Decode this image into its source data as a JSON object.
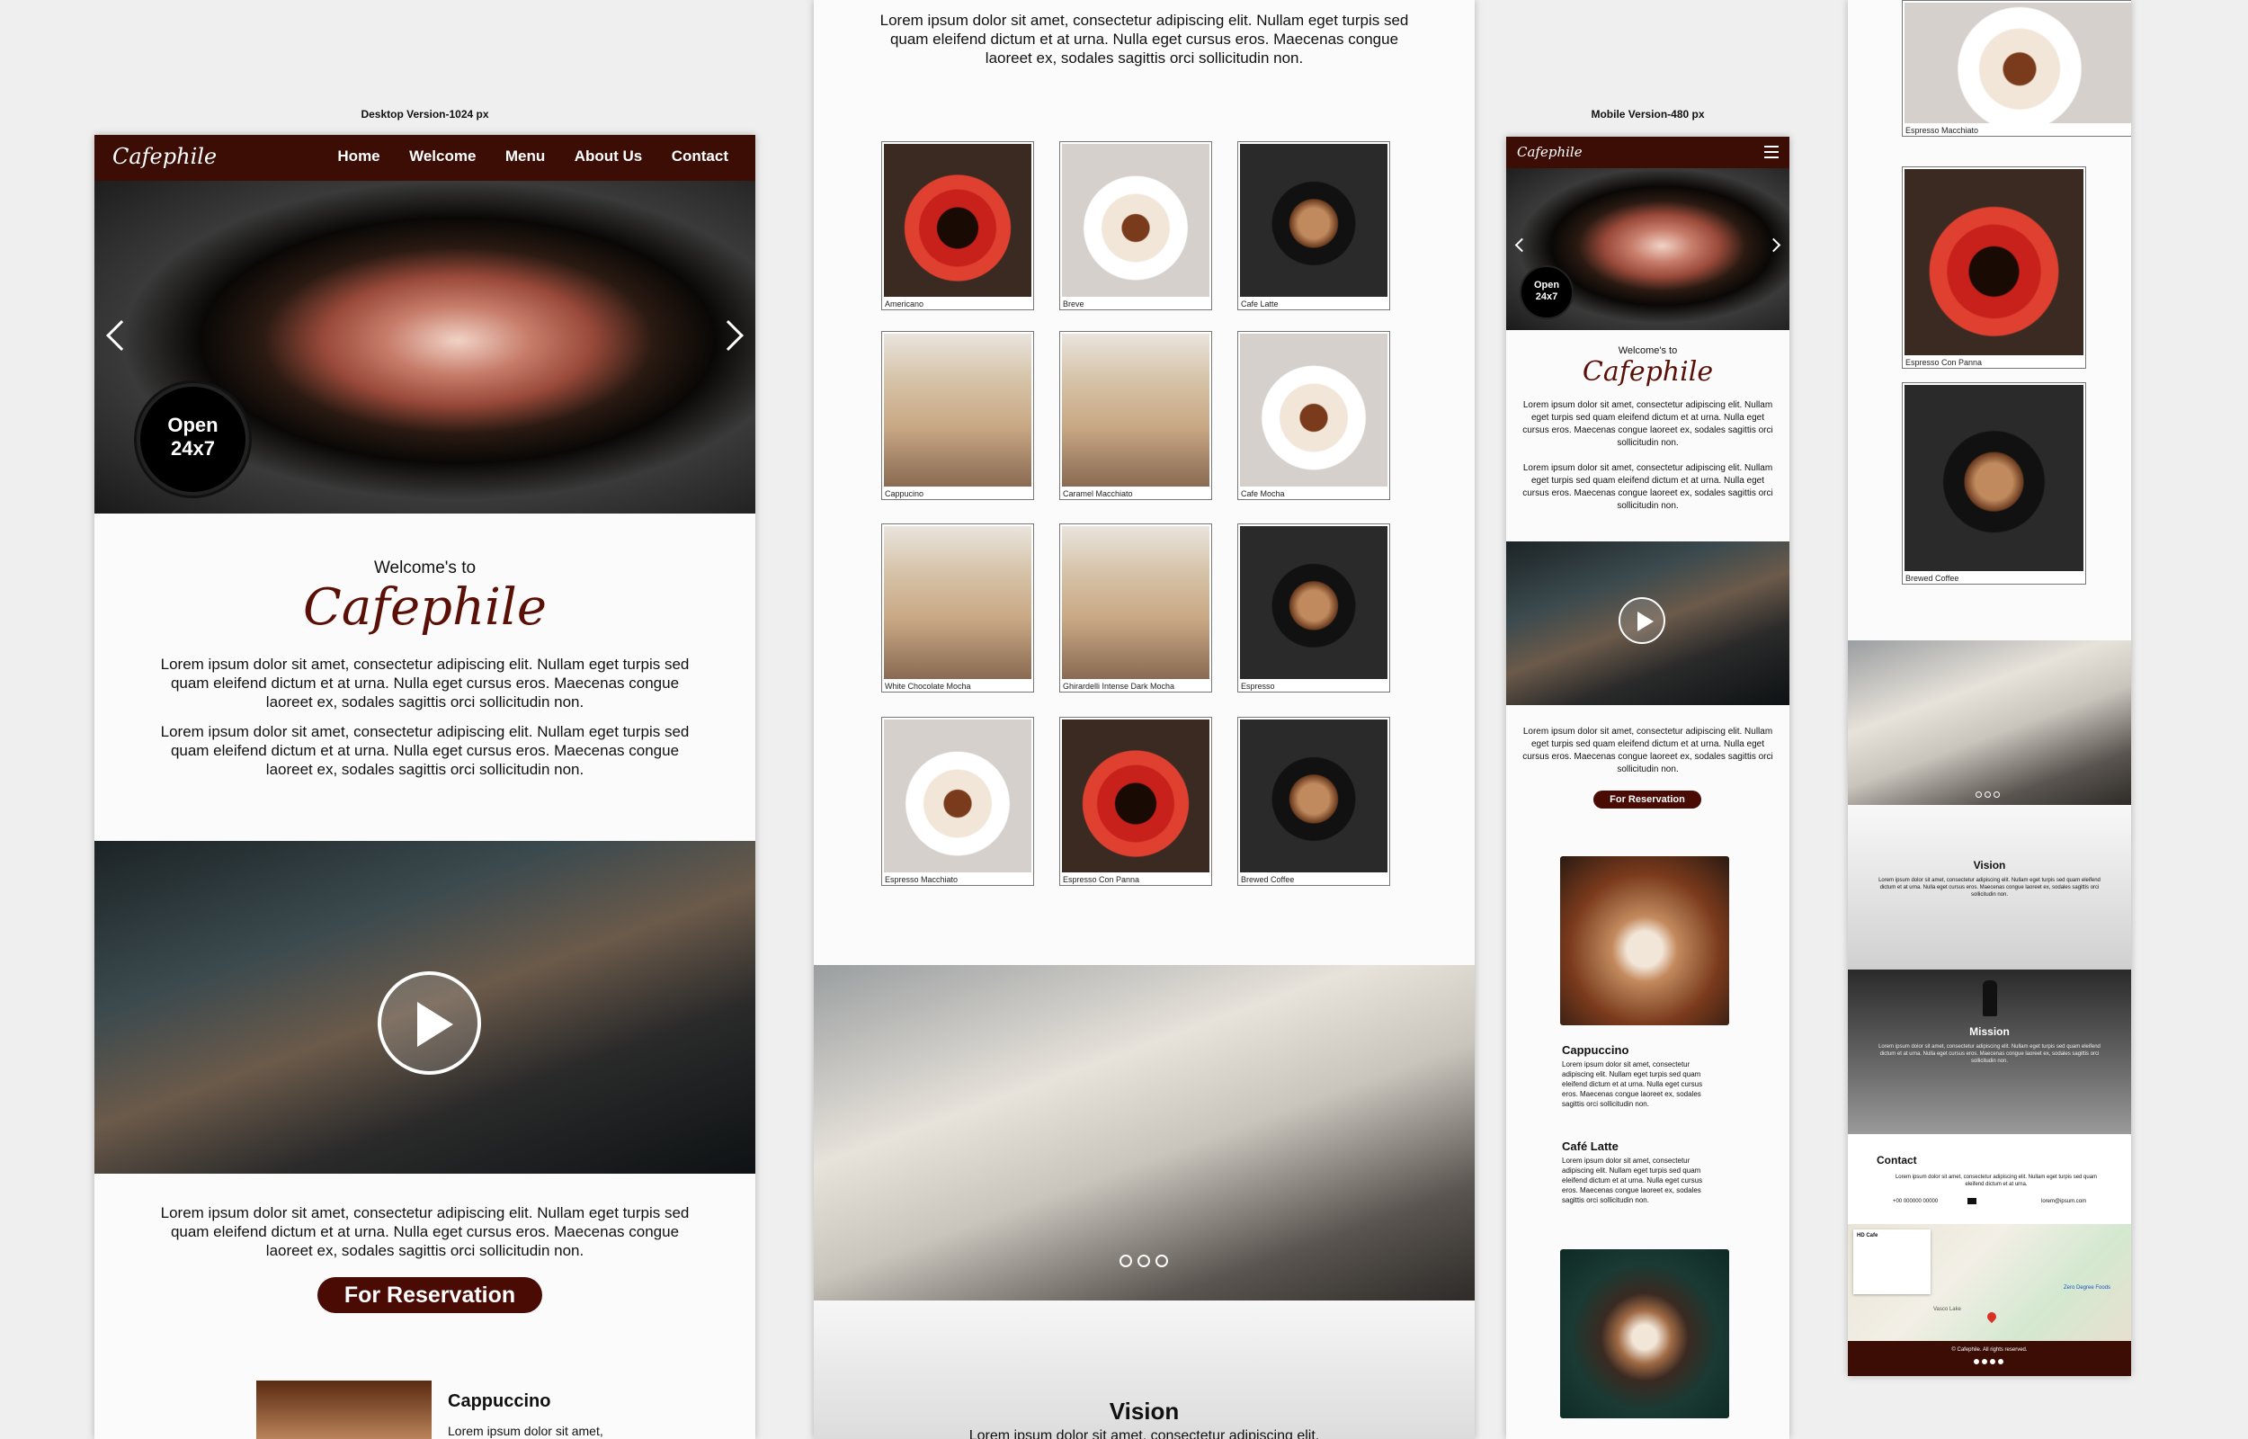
{
  "labels": {
    "desktop": "Desktop Version-1024 px",
    "mobile": "Mobile Version-480 px"
  },
  "brand": {
    "logo": "Cafephile",
    "brown": "#3b0d05"
  },
  "nav": {
    "items": [
      "Home",
      "Welcome",
      "Menu",
      "About Us",
      "Contact"
    ],
    "hamburger": "hamburger-icon"
  },
  "hero": {
    "open_line1": "Open",
    "open_line2": "24x7",
    "prev": "chevron-left-icon",
    "next": "chevron-right-icon"
  },
  "welcome": {
    "pre": "Welcome's to",
    "title": "Cafephile",
    "p1": "Lorem ipsum dolor sit amet, consectetur adipiscing elit. Nullam eget turpis sed quam eleifend dictum et at urna. Nulla eget cursus eros. Maecenas congue laoreet ex, sodales sagittis orci sollicitudin non.",
    "p2": "Lorem ipsum dolor sit amet, consectetur adipiscing elit. Nullam eget turpis sed quam eleifend dictum et at urna. Nulla eget cursus eros. Maecenas congue laoreet ex, sodales sagittis orci sollicitudin non."
  },
  "video": {
    "text": "Lorem ipsum dolor sit amet, consectetur adipiscing elit. Nullam eget turpis sed quam eleifend dictum et at urna. Nulla eget cursus eros. Maecenas congue laoreet ex, sodales sagittis orci sollicitudin non.",
    "button": "For Reservation"
  },
  "desk_bottom": {
    "title": "Cappuccino",
    "text": "Lorem ipsum dolor sit amet,"
  },
  "mid_top": "Lorem ipsum dolor sit amet, consectetur adipiscing elit. Nullam eget turpis sed quam eleifend dictum et at urna. Nulla eget cursus eros. Maecenas congue laoreet ex, sodales sagittis orci sollicitudin non.",
  "menu": [
    "Americano",
    "Breve",
    "Cafe Latte",
    "Cappucino",
    "Caramel Macchiato",
    "Cafe Mocha",
    "White Chocolate Mocha",
    "Ghirardelli Intense Dark Mocha",
    "Espresso",
    "Espresso Macchiato",
    "Espresso Con Panna",
    "Brewed Coffee"
  ],
  "vision": {
    "title": "Vision",
    "text": "Lorem ipsum dolor sit amet, consectetur adipiscing elit."
  },
  "mobile": {
    "p1": "Lorem ipsum dolor sit amet, consectetur adipiscing elit. Nullam eget turpis sed quam eleifend dictum et at urna. Nulla eget cursus eros. Maecenas congue laoreet ex, sodales sagittis orci sollicitudin non.",
    "p2": "Lorem ipsum dolor sit amet, consectetur adipiscing elit. Nullam eget turpis sed quam eleifend dictum et at urna. Nulla eget cursus eros. Maecenas congue laoreet ex, sodales sagittis orci sollicitudin non.",
    "p3": "Lorem ipsum dolor sit amet, consectetur adipiscing elit. Nullam eget turpis sed quam eleifend dictum et at urna. Nulla eget cursus eros. Maecenas congue laoreet ex, sodales sagittis orci sollicitudin non.",
    "cap_title": "Cappuccino",
    "cap_text": "Lorem ipsum dolor sit amet, consectetur adipiscing elit. Nullam eget turpis sed quam eleifend dictum et at urna. Nulla eget cursus eros. Maecenas congue laoreet ex, sodales sagittis orci sollicitudin non.",
    "latte_title": "Café Latte",
    "latte_text": "Lorem ipsum dolor sit amet, consectetur adipiscing elit. Nullam eget turpis sed quam eleifend dictum et at urna. Nulla eget cursus eros. Maecenas congue laoreet ex, sodales sagittis orci sollicitudin non."
  },
  "right": {
    "tiles": [
      "Espresso Macchiato",
      "Espresso Con Panna",
      "Brewed Coffee"
    ],
    "vision": "Vision",
    "mission": "Mission",
    "small_text": "Lorem ipsum dolor sit amet, consectetur adipiscing elit. Nullam eget turpis sed quam eleifend dictum et at urna. Nulla eget cursus eros. Maecenas congue laoreet ex, sodales sagittis orci sollicitudin non.",
    "contact": "Contact",
    "contact_text": "Lorem ipsum dolor sit amet, consectetur adipiscing elit. Nullam eget turpis sed quam eleifend dictum et at urna.",
    "phone": "+00 000000 00000",
    "email": "lorem@ipsum.com",
    "map_name": "HD Cafe",
    "map_label1": "Zero Degree Foods",
    "map_label2": "Vasco Lake",
    "footer": "© Cafephile. All rights reserved."
  }
}
